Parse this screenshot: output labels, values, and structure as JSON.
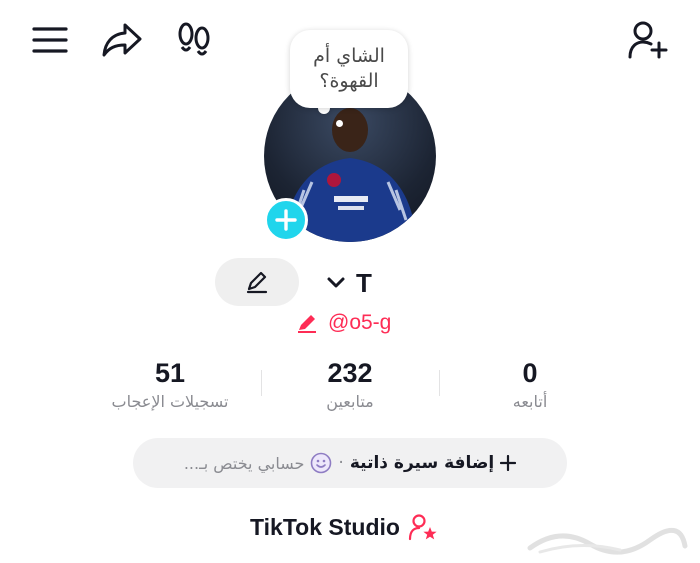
{
  "top_bar": {
    "menu_icon": "menu-icon",
    "share_icon": "share-icon",
    "footprint_icon": "footprint-icon",
    "add_friend_icon": "add-friend-icon"
  },
  "bubble": {
    "line1": "الشاي أم",
    "line2": "القهوة؟"
  },
  "profile": {
    "name": "T",
    "handle": "@o5-g"
  },
  "stats": {
    "following": {
      "value": "0",
      "label": "أتابعه"
    },
    "followers": {
      "value": "232",
      "label": "متابعين"
    },
    "likes": {
      "value": "51",
      "label": "تسجيلات الإعجاب"
    }
  },
  "bio": {
    "add_label": "إضافة سيرة ذاتية",
    "separator": "·",
    "placeholder": "حسابي يختص بـ..."
  },
  "studio": {
    "label": "TikTok Studio"
  },
  "colors": {
    "accent_red": "#fe2c55",
    "accent_cyan": "#20d5ec",
    "text": "#161823",
    "muted": "#8a8b91"
  }
}
